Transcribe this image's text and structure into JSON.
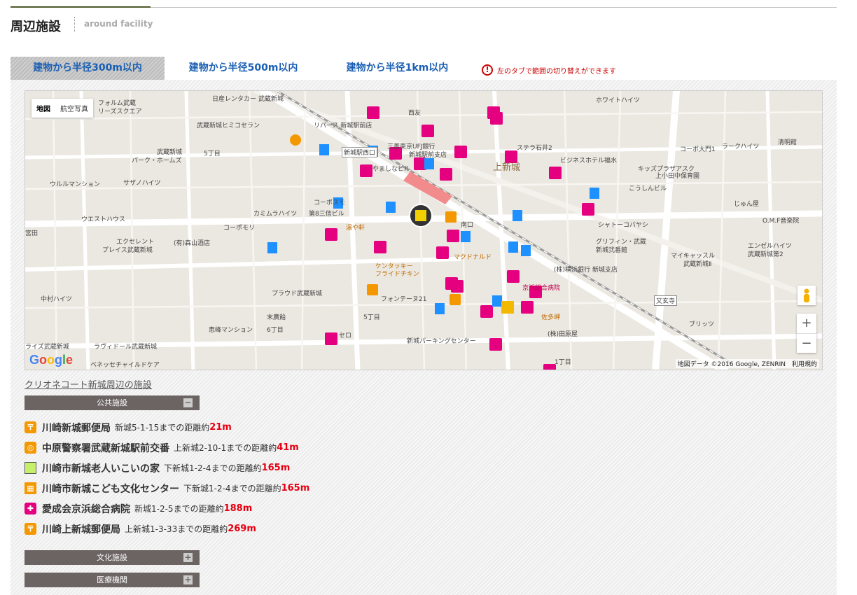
{
  "header": {
    "title": "周辺施設",
    "subtitle": "around facility"
  },
  "tabs": [
    {
      "label": "建物から半径300m以内",
      "active": true
    },
    {
      "label": "建物から半径500m以内",
      "active": false
    },
    {
      "label": "建物から半径1km以内",
      "active": false
    }
  ],
  "tab_note": {
    "icon": "warning-circle-icon",
    "text": "左のタブで範囲の切り替えができます"
  },
  "map": {
    "type_buttons": [
      "地図",
      "航空写真"
    ],
    "zoom_in": "+",
    "zoom_out": "−",
    "logo": "Google",
    "attribution": "地図データ ©2016 Google, ZENRIN　利用規約",
    "labels": {
      "l1": "日産レンタカー 武蔵新城",
      "l2": "ホワイトハイツ",
      "l3": "西友",
      "l4": "リパース 新城駅前店",
      "l5": "三菱東京UFJ銀行",
      "l6": "新城駅前支店",
      "l7": "武蔵新城ヒミコセラン",
      "l8": "新城駅西口",
      "l9": "武蔵新城",
      "l10": "パーク・ホームズ",
      "l11": "5丁目",
      "l12": "上新城",
      "l13": "ステラ石井2",
      "l14": "ビジネスホテル福水",
      "l15": "コーポ大門1",
      "l16": "ラークハイツ",
      "l17": "清明館",
      "l18": "キッズプラザアスク",
      "l19": "上小田中保育園",
      "l20": "ウルルマンション",
      "l21": "サザノハイツ",
      "l22": "カミムラハイツ",
      "l23": "第8三信ビル",
      "l24": "コーポモリ",
      "l25": "湯や軒",
      "l26": "南口",
      "l27": "シャトーコバヤシ",
      "l28": "O.M.F音楽院",
      "l29": "エクセレント",
      "l30": "プレイス武蔵新城",
      "l31": "(有)森山酒店",
      "l32": "マクドナルド",
      "l33": "グリフィン・武蔵",
      "l34": "新城弐番館",
      "l35": "エンゼルハイツ",
      "l36": "武蔵新城第2",
      "l37": "マイキャッスル",
      "l38": "武蔵新城Ⅱ",
      "l39": "ケンタッキー",
      "l40": "フライドチキン",
      "l41": "(株)横浜銀行 新城支店",
      "l42": "プラウド武蔵新城",
      "l43": "フォンテーヌ21",
      "l44": "京浜総合病院",
      "l45": "中村ハイツ",
      "l46": "末廣飴",
      "l47": "5丁目",
      "l48": "佐多岬",
      "l49": "又玄寺",
      "l50": "恵峰マンション",
      "l51": "6丁目",
      "l52": "(株)田原屋",
      "l53": "ブリッツ",
      "l54": "ライズ武蔵新城",
      "l55": "ラヴィドール武蔵新城",
      "l56": "新城パーキングセンター",
      "l57": "ベネッセチャイルドケア",
      "l58": "1丁目",
      "l59": "こうしんビル",
      "l60": "じゅん屋",
      "l61": "フォルム武蔵",
      "l62": "リーズスクエア",
      "l63": "ウエストハウス",
      "l64": "宮田",
      "l65": "やましなビル",
      "l66": "コーポスモ",
      "l67": "セロ"
    }
  },
  "caption": "クリオネコート新城周辺の施設",
  "categories": {
    "public": {
      "label": "公共施設",
      "toggle": "−"
    },
    "culture": {
      "label": "文化施設",
      "toggle": "+"
    },
    "medical": {
      "label": "医療機関",
      "toggle": "+"
    }
  },
  "facilities": [
    {
      "icon": "post-office-icon",
      "color": "#f39800",
      "name": "川崎新城郵便局",
      "address": "新城5-1-15までの距離約",
      "distance": "21m"
    },
    {
      "icon": "police-box-icon",
      "color": "#f39800",
      "name": "中原警察署武蔵新城駅前交番",
      "address": "上新城2-10-1までの距離約",
      "distance": "41m"
    },
    {
      "icon": "elderly-home-icon",
      "color": "#c6f06a",
      "name": "川崎市新城老人いこいの家",
      "address": "下新城1-2-4までの距離約",
      "distance": "165m"
    },
    {
      "icon": "culture-center-icon",
      "color": "#f39800",
      "name": "川崎市新城こども文化センター",
      "address": "下新城1-2-4までの距離約",
      "distance": "165m"
    },
    {
      "icon": "hospital-icon",
      "color": "#e4007f",
      "name": "愛成会京浜総合病院",
      "address": "新城1-2-5までの距離約",
      "distance": "188m"
    },
    {
      "icon": "post-office-icon",
      "color": "#f39800",
      "name": "川崎上新城郵便局",
      "address": "上新城1-3-33までの距離約",
      "distance": "269m"
    }
  ]
}
